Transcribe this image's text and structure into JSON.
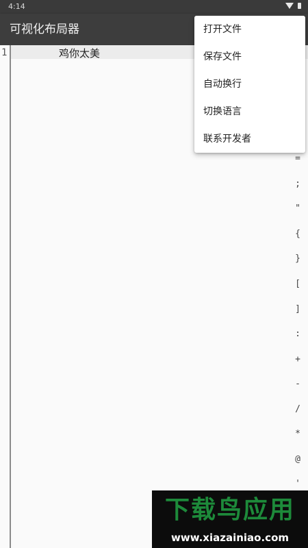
{
  "status_bar": {
    "time": "4:14",
    "wifi_icon": "wifi-icon",
    "battery_icon": "battery-icon"
  },
  "app_bar": {
    "title": "可视化布局器"
  },
  "editor": {
    "line_number": "1",
    "line_text": "鸡你太美",
    "symbols": [
      "=",
      ";",
      "\"",
      "{",
      "}",
      "[",
      "]",
      ":",
      "+",
      "-",
      "/",
      "*",
      "@",
      "'"
    ]
  },
  "menu": {
    "items": [
      {
        "label": "打开文件"
      },
      {
        "label": "保存文件"
      },
      {
        "label": "自动换行"
      },
      {
        "label": "切换语言"
      },
      {
        "label": "联系开发者"
      }
    ]
  },
  "watermark": {
    "title": "下载鸟应用",
    "url": "www.xiazainiao.com"
  },
  "colors": {
    "app_bar": "#3d3d3d",
    "status_bar": "#3a3a3a",
    "background": "#fafafa",
    "menu_background": "#ffffff",
    "watermark_green": "#1d8a3a"
  }
}
